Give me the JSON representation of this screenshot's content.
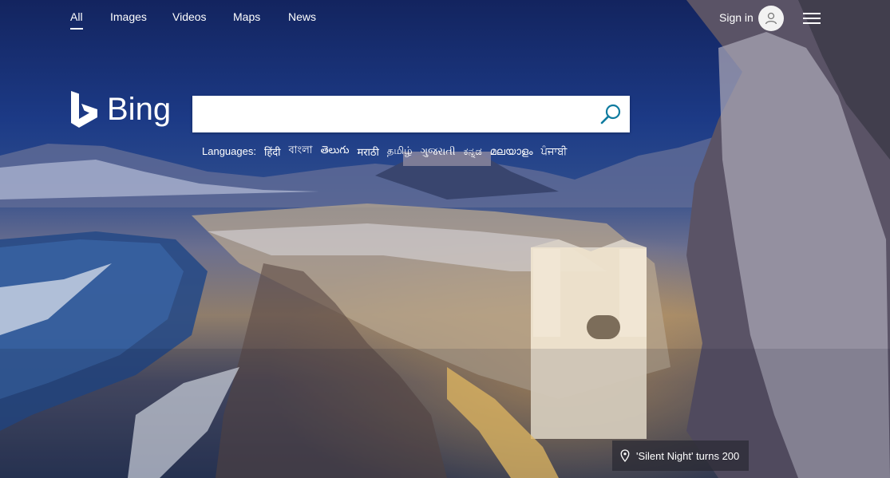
{
  "nav": {
    "items": [
      {
        "label": "All",
        "active": true
      },
      {
        "label": "Images",
        "active": false
      },
      {
        "label": "Videos",
        "active": false
      },
      {
        "label": "Maps",
        "active": false
      },
      {
        "label": "News",
        "active": false
      }
    ],
    "signin_label": "Sign in"
  },
  "logo": {
    "text": "Bing"
  },
  "search": {
    "value": "",
    "placeholder": ""
  },
  "languages": {
    "label": "Languages:",
    "items": [
      "हिंदी",
      "বাংলা",
      "తెలుగు",
      "मराठी",
      "தமிழ்",
      "ગુજરાતી",
      "ಕನ್ನಡ",
      "മലയാളം",
      "ਪੰਜਾਬੀ"
    ]
  },
  "caption": {
    "text": "'Silent Night' turns 200"
  },
  "colors": {
    "search_icon": "#0f7b9f",
    "caption_bg": "#2a2a33"
  },
  "icons": {
    "logo": "bing-b-icon",
    "search": "search-icon",
    "avatar": "user-icon",
    "menu": "hamburger-menu-icon",
    "caption": "location-pin-icon"
  }
}
